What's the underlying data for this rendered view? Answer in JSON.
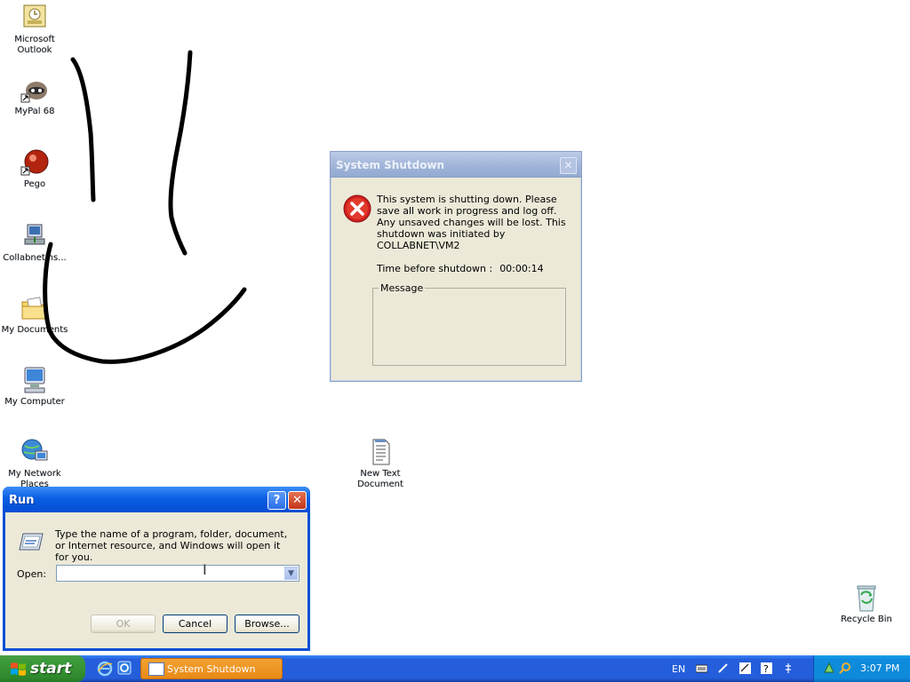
{
  "desktop": {
    "icons": [
      {
        "label": "Microsoft Outlook"
      },
      {
        "label": "MyPal 68"
      },
      {
        "label": "Pego"
      },
      {
        "label": "Collabnetins..."
      },
      {
        "label": "My Documents"
      },
      {
        "label": "My Computer"
      },
      {
        "label": "My Network Places"
      },
      {
        "label": "New Text Document"
      },
      {
        "label": "Recycle Bin"
      }
    ]
  },
  "shutdown_dialog": {
    "title": "System Shutdown",
    "close_glyph": "✕",
    "message": "This system is shutting down. Please save all work in progress and log off. Any unsaved changes will be lost. This shutdown was initiated by COLLABNET\\VM2",
    "time_label": "Time before shutdown :",
    "time_value": "00:00:14",
    "group_label": "Message",
    "icon": "error-icon"
  },
  "run_dialog": {
    "title": "Run",
    "help_glyph": "?",
    "close_glyph": "✕",
    "description": "Type the name of a program, folder, document, or Internet resource, and Windows will open it for you.",
    "open_label": "Open:",
    "open_value": "",
    "ok_label": "OK",
    "cancel_label": "Cancel",
    "browse_label": "Browse..."
  },
  "taskbar": {
    "start_label": "start",
    "task_label": "System Shutdown",
    "language": "EN",
    "clock": "3:07 PM"
  },
  "colors": {
    "taskbar_blue": "#245edb",
    "start_green": "#3c9b3a",
    "task_orange": "#e98a16",
    "error_red": "#d21f1f"
  }
}
